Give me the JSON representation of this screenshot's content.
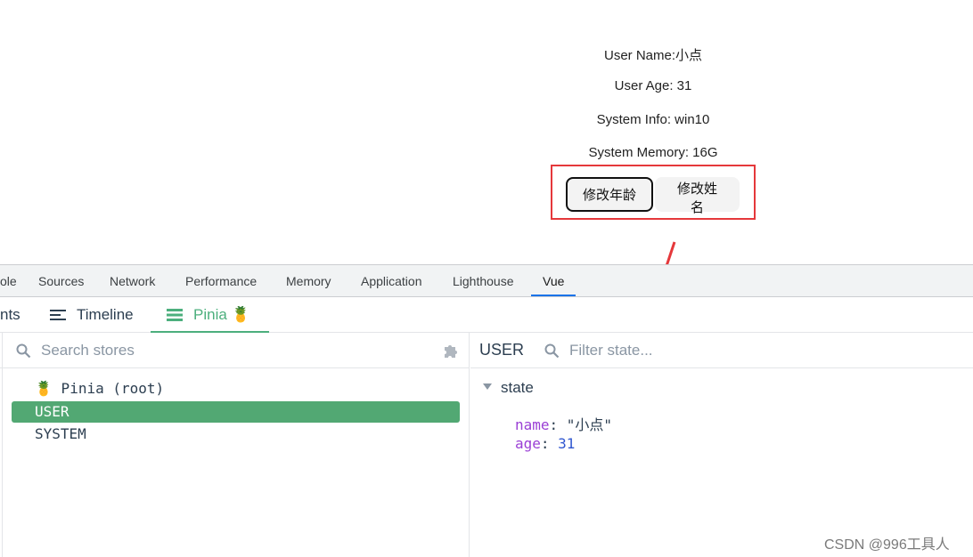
{
  "app": {
    "user_name": "User Name:小点",
    "user_age": "User Age: 31",
    "system_info": "System Info: win10",
    "system_memory": "System Memory: 16G",
    "buttons": {
      "change_age": "修改年龄",
      "change_name": "修改姓名"
    }
  },
  "devtools": {
    "tabs": [
      "ole",
      "Sources",
      "Network",
      "Performance",
      "Memory",
      "Application",
      "Lighthouse",
      "Vue"
    ],
    "active_tab": "Vue",
    "vue_tabs": {
      "components_partial": "nts",
      "timeline": "Timeline",
      "pinia": "Pinia 🍍"
    },
    "search_placeholder": "Search stores",
    "stores": [
      "🍍 Pinia (root)",
      "USER",
      "SYSTEM"
    ],
    "selected_store": "USER",
    "inspector": {
      "store_name": "USER",
      "filter_placeholder": "Filter state...",
      "section": "state",
      "state": [
        {
          "key": "name",
          "value": "\"小点\"",
          "type": "string"
        },
        {
          "key": "age",
          "value": "31",
          "type": "number"
        }
      ]
    }
  },
  "annotations": {
    "highlight_color": "#e5383b"
  },
  "watermark": "CSDN @996工具人"
}
